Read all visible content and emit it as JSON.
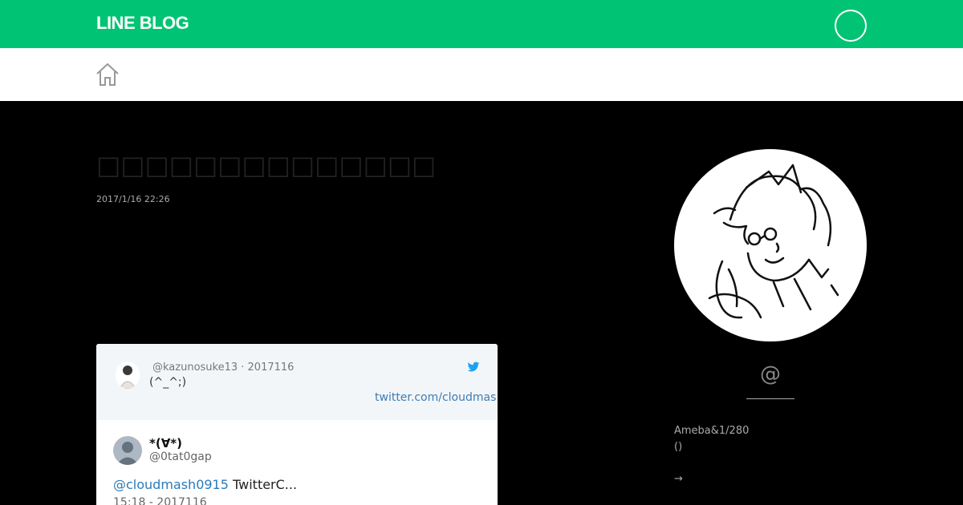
{
  "header": {
    "logo": "LINE BLOG"
  },
  "article": {
    "title": "□□□□□□□□□□□□□□",
    "date": "2017/1/16 22:26"
  },
  "embed": {
    "top_handle": "@kazunosuke13 · 2017116",
    "top_text": "(^_^;)",
    "top_link": "twitter.com/cloudmas",
    "name": "*(∀*)",
    "handle": "@0tat0gap",
    "body_mention": "@cloudmash0915",
    "body_text": " TwitterC...",
    "time": "15:18 - 2017116"
  },
  "sidebar": {
    "at": "@",
    "info_line1": "Ameba&1/280",
    "info_line2": "()",
    "arrow": "→"
  },
  "colors": {
    "brand": "#00c473",
    "link": "#2b7bb9",
    "twitter": "#1da1f2"
  }
}
